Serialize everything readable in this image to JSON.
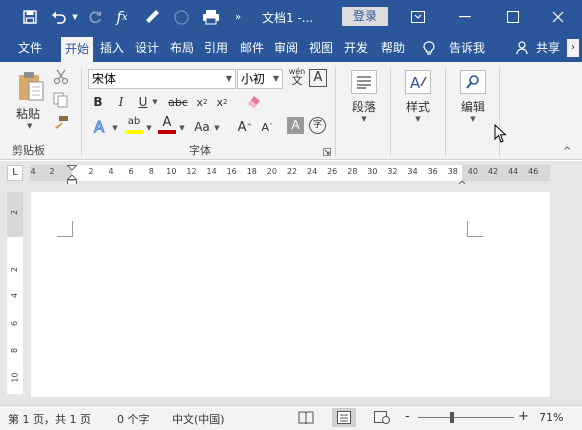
{
  "titlebar": {
    "doc_title": "文档1 -...",
    "login_label": "登录"
  },
  "tabs": [
    {
      "label": "文件"
    },
    {
      "label": "开始",
      "active": true
    },
    {
      "label": "插入"
    },
    {
      "label": "设计"
    },
    {
      "label": "布局"
    },
    {
      "label": "引用"
    },
    {
      "label": "邮件"
    },
    {
      "label": "审阅"
    },
    {
      "label": "视图"
    },
    {
      "label": "开发"
    },
    {
      "label": "帮助"
    },
    {
      "label": "告诉我"
    },
    {
      "label": "共享"
    }
  ],
  "ribbon": {
    "clipboard": {
      "paste_label": "粘贴",
      "group_label": "剪贴板"
    },
    "font": {
      "font_name": "宋体",
      "font_size": "小初",
      "phonetic_top": "wén",
      "phonetic_bottom": "文",
      "border_char": "A",
      "bold": "B",
      "italic": "I",
      "underline": "U",
      "strike": "abc",
      "sub": "x",
      "sub_mark": "2",
      "sup": "x",
      "sup_mark": "2",
      "highlight_text": "ab",
      "font_color_text": "A",
      "change_case": "Aa",
      "grow": "A",
      "shrink": "A",
      "shading_char": "A",
      "enclose_char": "字",
      "group_label": "字体"
    },
    "paragraph": {
      "label": "段落"
    },
    "styles": {
      "label": "样式"
    },
    "editing": {
      "label": "编辑"
    }
  },
  "ruler": {
    "corner": "L",
    "left_numbers": [
      "4",
      "2"
    ],
    "numbers": [
      "2",
      "4",
      "6",
      "8",
      "10",
      "12",
      "14",
      "16",
      "18",
      "20",
      "22",
      "24",
      "26",
      "28",
      "30",
      "32",
      "34",
      "36",
      "38",
      "40",
      "42",
      "44",
      "46"
    ],
    "vertical_numbers": [
      "2",
      "2",
      "4",
      "6",
      "8",
      "10"
    ]
  },
  "statusbar": {
    "page_info": "第 1 页，共 1 页",
    "word_count": "0 个字",
    "language": "中文(中国)",
    "zoom_minus": "-",
    "zoom_plus": "+",
    "zoom_level": "71%",
    "zoom_fraction": 0.35
  },
  "colors": {
    "brand": "#2b579a",
    "highlight": "#ffff00",
    "font_color": "#c00000"
  }
}
